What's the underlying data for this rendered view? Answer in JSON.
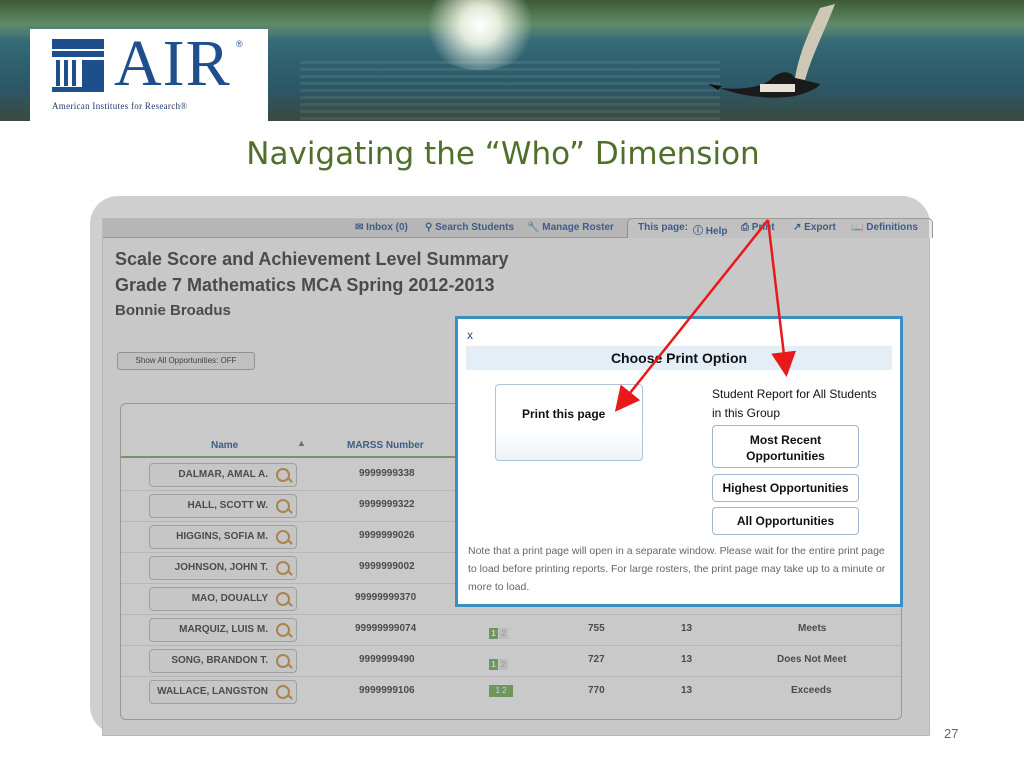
{
  "slide": {
    "title": "Navigating the “Who” Dimension",
    "page_number": "27"
  },
  "logo": {
    "name": "AIR",
    "registered": "®",
    "subtitle": "American Institutes for Research®"
  },
  "app": {
    "topbar": {
      "inbox": "Inbox (0)",
      "search_students": "Search Students",
      "manage_roster": "Manage Roster",
      "this_page": "This page:",
      "help": "Help",
      "print": "Print",
      "export": "Export",
      "definitions": "Definitions"
    },
    "heading1": "Scale Score and Achievement Level Summary",
    "heading2": "Grade 7 Mathematics MCA Spring 2012-2013",
    "heading3": "Bonnie Broadus",
    "opportunities_toggle": "Show All Opportunities: OFF",
    "table": {
      "columns": {
        "name": "Name",
        "marss": "MARSS Number"
      },
      "rows": [
        {
          "name": "DALMAR, AMAL A.",
          "marss": "9999999338",
          "level": "",
          "score": "",
          "count": "",
          "result": ""
        },
        {
          "name": "HALL, SCOTT W.",
          "marss": "9999999322",
          "level": "",
          "score": "",
          "count": "",
          "result": ""
        },
        {
          "name": "HIGGINS, SOFIA M.",
          "marss": "9999999026",
          "level": "",
          "score": "",
          "count": "",
          "result": ""
        },
        {
          "name": "JOHNSON, JOHN T.",
          "marss": "9999999002",
          "level": "",
          "score": "",
          "count": "",
          "result": ""
        },
        {
          "name": "MAO, DOUALLY",
          "marss": "99999999370",
          "level": "",
          "score": "",
          "count": "",
          "result": ""
        },
        {
          "name": "MARQUIZ, LUIS M.",
          "marss": "99999999074",
          "level": "1",
          "score": "755",
          "count": "13",
          "result": "Meets"
        },
        {
          "name": "SONG, BRANDON T.",
          "marss": "9999999490",
          "level": "1",
          "score": "727",
          "count": "13",
          "result": "Does Not Meet"
        },
        {
          "name": "WALLACE, LANGSTON",
          "marss": "9999999106",
          "level": "1 2",
          "score": "770",
          "count": "13",
          "result": "Exceeds"
        }
      ]
    }
  },
  "modal": {
    "close": "x",
    "title": "Choose Print Option",
    "print_this_page": "Print this page",
    "report_label": "Student Report for All Students in this Group",
    "btn_most_recent": "Most Recent Opportunities",
    "btn_highest": "Highest Opportunities",
    "btn_all": "All Opportunities",
    "note": "Note that a print page will open in a separate window. Please wait for the entire print page to load before printing reports. For large rosters, the print page may take up to a minute or more to load."
  },
  "colors": {
    "title_green": "#4f6f2a",
    "air_blue": "#1f4e8c",
    "modal_border": "#3a8ec4",
    "arrow_red": "#e8191a"
  }
}
